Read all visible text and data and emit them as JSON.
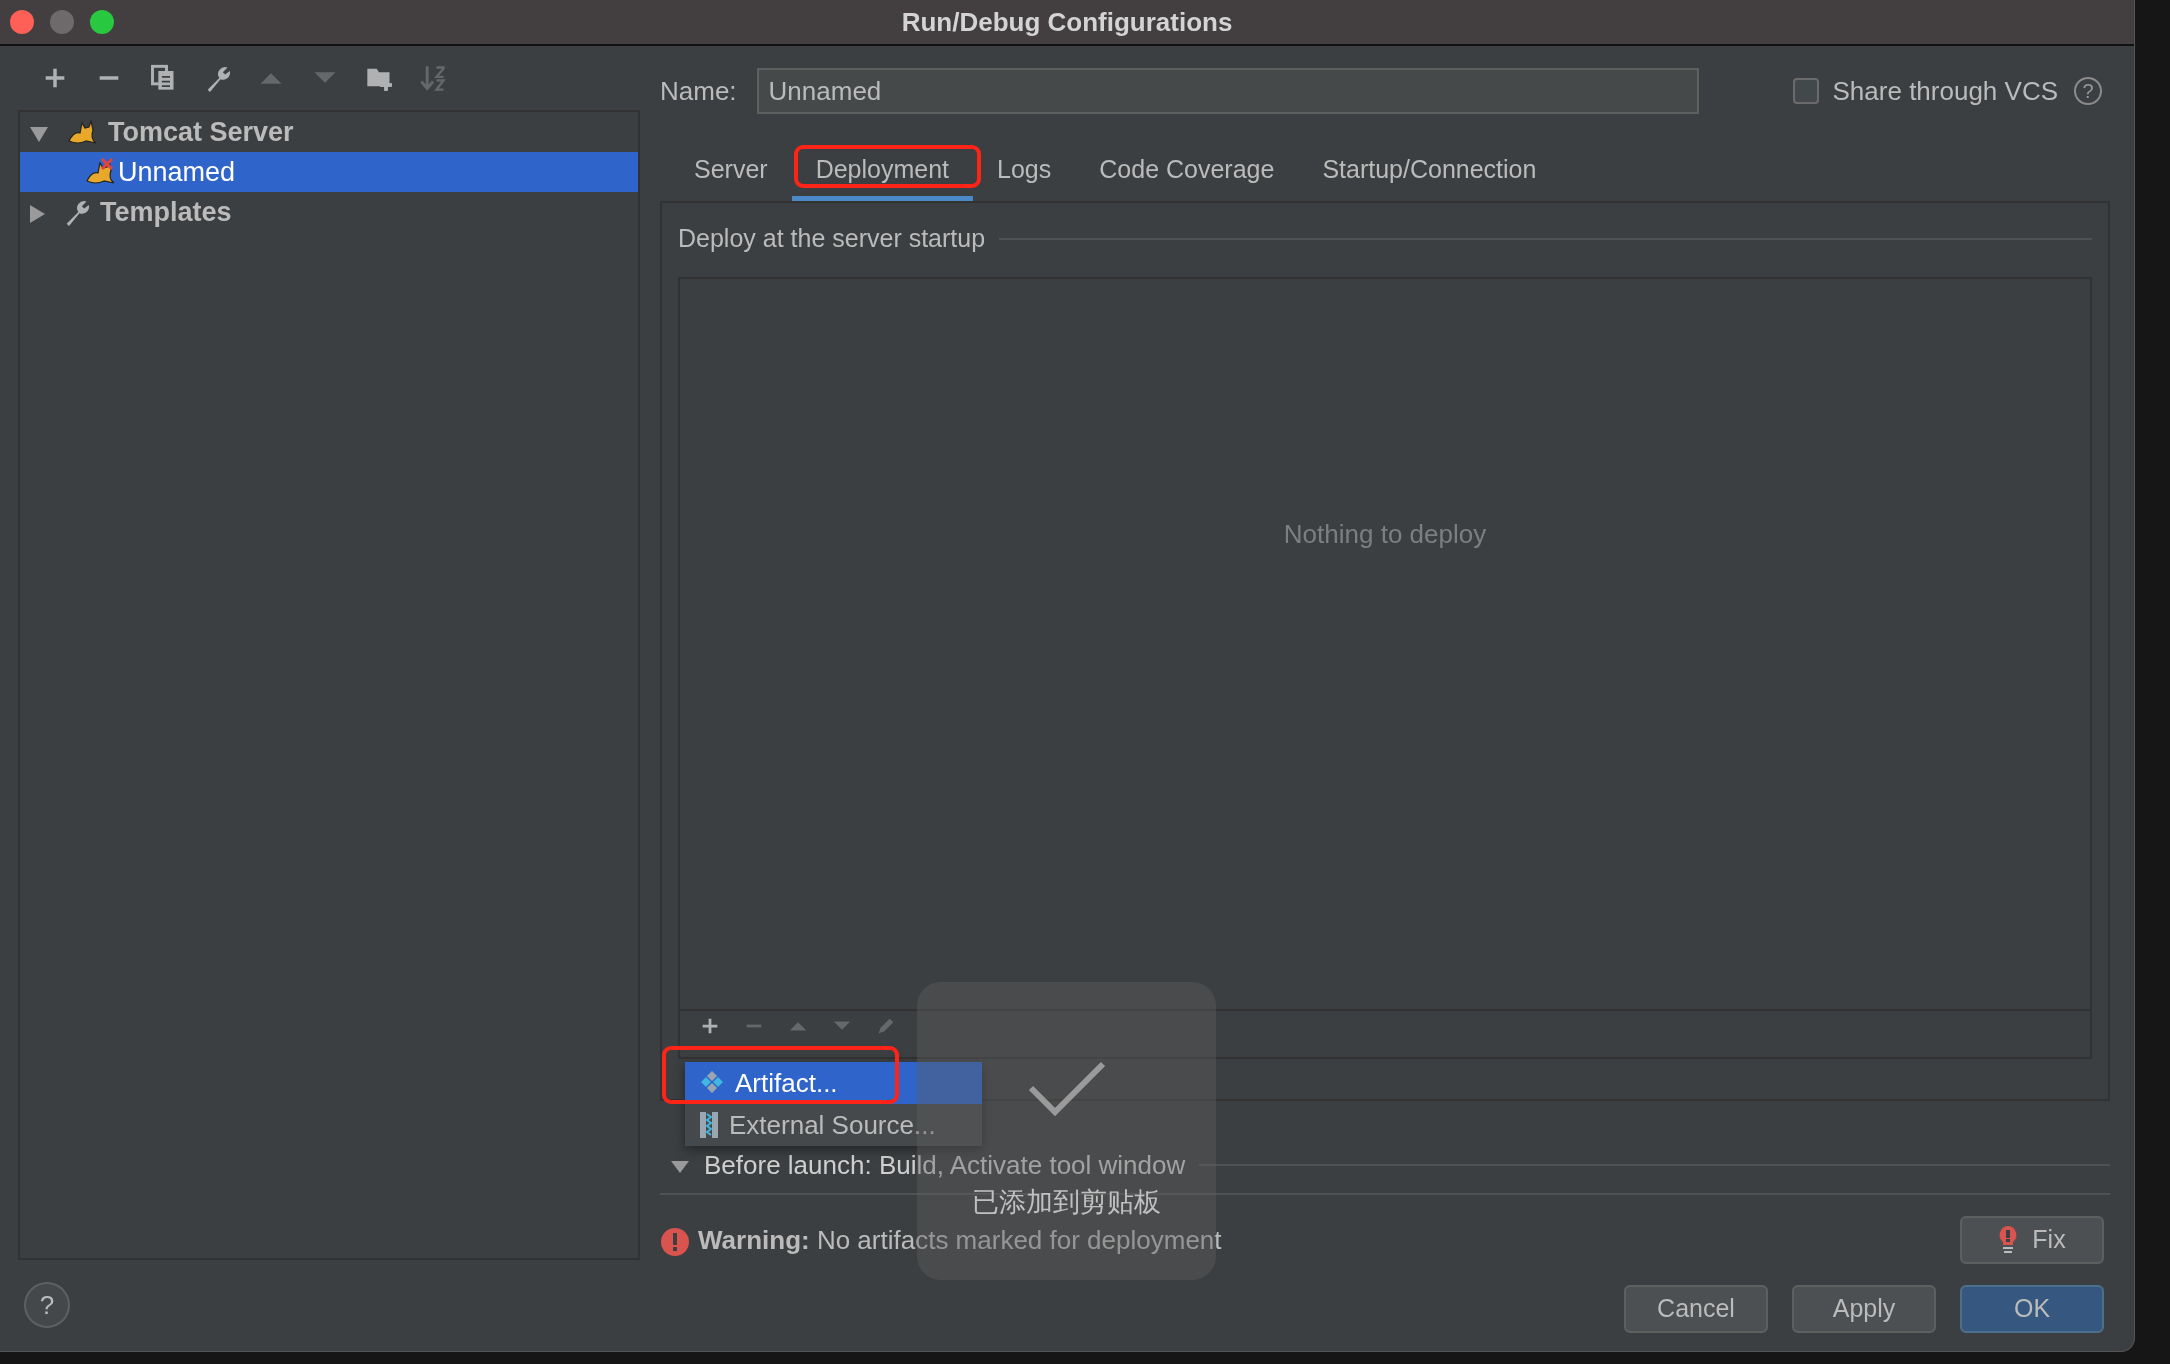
{
  "window": {
    "title": "Run/Debug Configurations"
  },
  "toolbar": [
    {
      "kind": "add",
      "disabled": false
    },
    {
      "kind": "remove",
      "disabled": false
    },
    {
      "kind": "copy",
      "disabled": false
    },
    {
      "kind": "wrench",
      "disabled": false
    },
    {
      "kind": "up",
      "disabled": true
    },
    {
      "kind": "down",
      "disabled": true
    },
    {
      "kind": "folder",
      "disabled": false
    },
    {
      "kind": "sort",
      "disabled": true
    }
  ],
  "tree": [
    {
      "label": "Tomcat Server",
      "kind": "tomcat",
      "expanded": true,
      "selected": false,
      "children": [
        {
          "label": "Unnamed",
          "kind": "tomcat-error",
          "selected": true
        }
      ]
    },
    {
      "label": "Templates",
      "kind": "wrench",
      "expanded": false,
      "selected": false
    }
  ],
  "help_button": "?",
  "name_field": {
    "label": "Name:",
    "value": "Unnamed"
  },
  "share": {
    "label": "Share through VCS",
    "checked": false,
    "help": "?"
  },
  "tabs": [
    {
      "label": "Server",
      "selected": false,
      "annotated": false
    },
    {
      "label": "Deployment",
      "selected": true,
      "annotated": true
    },
    {
      "label": "Logs",
      "selected": false,
      "annotated": false
    },
    {
      "label": "Code Coverage",
      "selected": false,
      "annotated": false
    },
    {
      "label": "Startup/Connection",
      "selected": false,
      "annotated": false
    }
  ],
  "deployment": {
    "section_title": "Deploy at the server startup",
    "empty_text": "Nothing to deploy",
    "list_toolbar": [
      {
        "kind": "add",
        "disabled": false
      },
      {
        "kind": "remove",
        "disabled": true
      },
      {
        "kind": "up",
        "disabled": true
      },
      {
        "kind": "down",
        "disabled": true
      },
      {
        "kind": "edit",
        "disabled": true
      }
    ]
  },
  "add_menu": {
    "annotated": true,
    "items": [
      {
        "label": "Artifact...",
        "kind": "artifact",
        "selected": true
      },
      {
        "label": "External Source...",
        "kind": "external",
        "selected": false
      }
    ]
  },
  "before_launch": {
    "label": "Before launch: Build, Activate tool window",
    "expanded": true
  },
  "warning": {
    "text": "**Warning:** No artifacts marked for deployment"
  },
  "fix_button": "Fix",
  "buttons": [
    {
      "label": "Cancel",
      "default": false
    },
    {
      "label": "Apply",
      "default": false
    },
    {
      "label": "OK",
      "default": true
    }
  ],
  "toast": {
    "text": "已添加到剪贴板"
  }
}
